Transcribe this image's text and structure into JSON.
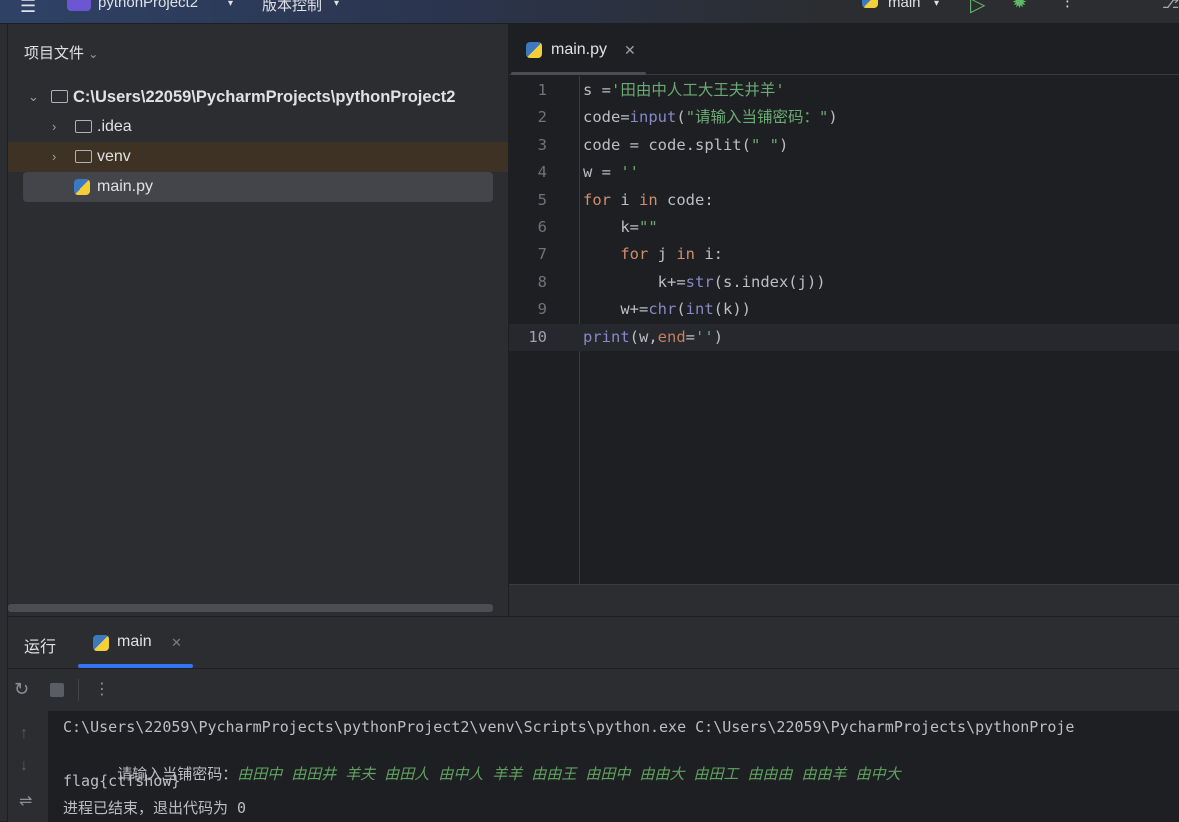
{
  "titlebar": {
    "project": "pythonProject2",
    "vcs": "版本控制",
    "run_config": "main",
    "project_badge": "PP"
  },
  "project_panel": {
    "title": "项目文件",
    "root": "C:\\Users\\22059\\PycharmProjects\\pythonProject2",
    "items": [
      {
        "label": ".idea",
        "type": "folder"
      },
      {
        "label": "venv",
        "type": "folder"
      },
      {
        "label": "main.py",
        "type": "python-file"
      }
    ]
  },
  "editor": {
    "tab": "main.py",
    "lines": [
      [
        [
          "id",
          "s ="
        ],
        [
          "st",
          "'田由中人工大王夫井羊'"
        ]
      ],
      [
        [
          "id",
          "code="
        ],
        [
          "bi",
          "input"
        ],
        [
          "id",
          "("
        ],
        [
          "st",
          "\"请输入当铺密码：\""
        ],
        [
          "id",
          ")"
        ]
      ],
      [
        [
          "id",
          "code = code.split("
        ],
        [
          "st",
          "\" \""
        ],
        [
          "id",
          ")"
        ]
      ],
      [
        [
          "id",
          "w = "
        ],
        [
          "st",
          "''"
        ]
      ],
      [
        [
          "kw",
          "for"
        ],
        [
          "id",
          " i "
        ],
        [
          "kw",
          "in"
        ],
        [
          "id",
          " code:"
        ]
      ],
      [
        [
          "id",
          "    k="
        ],
        [
          "st",
          "\"\""
        ]
      ],
      [
        [
          "id",
          "    "
        ],
        [
          "kw",
          "for"
        ],
        [
          "id",
          " j "
        ],
        [
          "kw",
          "in"
        ],
        [
          "id",
          " i:"
        ]
      ],
      [
        [
          "id",
          "        k+="
        ],
        [
          "bi",
          "str"
        ],
        [
          "id",
          "(s.index(j))"
        ]
      ],
      [
        [
          "id",
          "    w+="
        ],
        [
          "bi",
          "chr"
        ],
        [
          "id",
          "("
        ],
        [
          "bi",
          "int"
        ],
        [
          "id",
          "(k))"
        ]
      ],
      [
        [
          "bi",
          "print"
        ],
        [
          "id",
          "(w,"
        ],
        [
          "pa",
          "end"
        ],
        [
          "id",
          "="
        ],
        [
          "st",
          "''"
        ],
        [
          "id",
          ")"
        ]
      ]
    ]
  },
  "run_panel": {
    "title": "运行",
    "tab": "main",
    "console": {
      "cmd": "C:\\Users\\22059\\PycharmProjects\\pythonProject2\\venv\\Scripts\\python.exe C:\\Users\\22059\\PycharmProjects\\pythonProje",
      "prompt": "请输入当铺密码：",
      "input": "由田中 由田井 羊夫 由田人 由中人 羊羊 由由王 由田中 由由大 由田工 由由由 由由羊 由中大",
      "output": "flag{ctfshow}",
      "exit": "进程已结束，退出代码为 0"
    }
  },
  "colors": {
    "accent": "#3574f0",
    "keyword": "#cf8e6d",
    "string": "#6aab73",
    "builtin": "#8888c6",
    "run": "#5fb865"
  }
}
